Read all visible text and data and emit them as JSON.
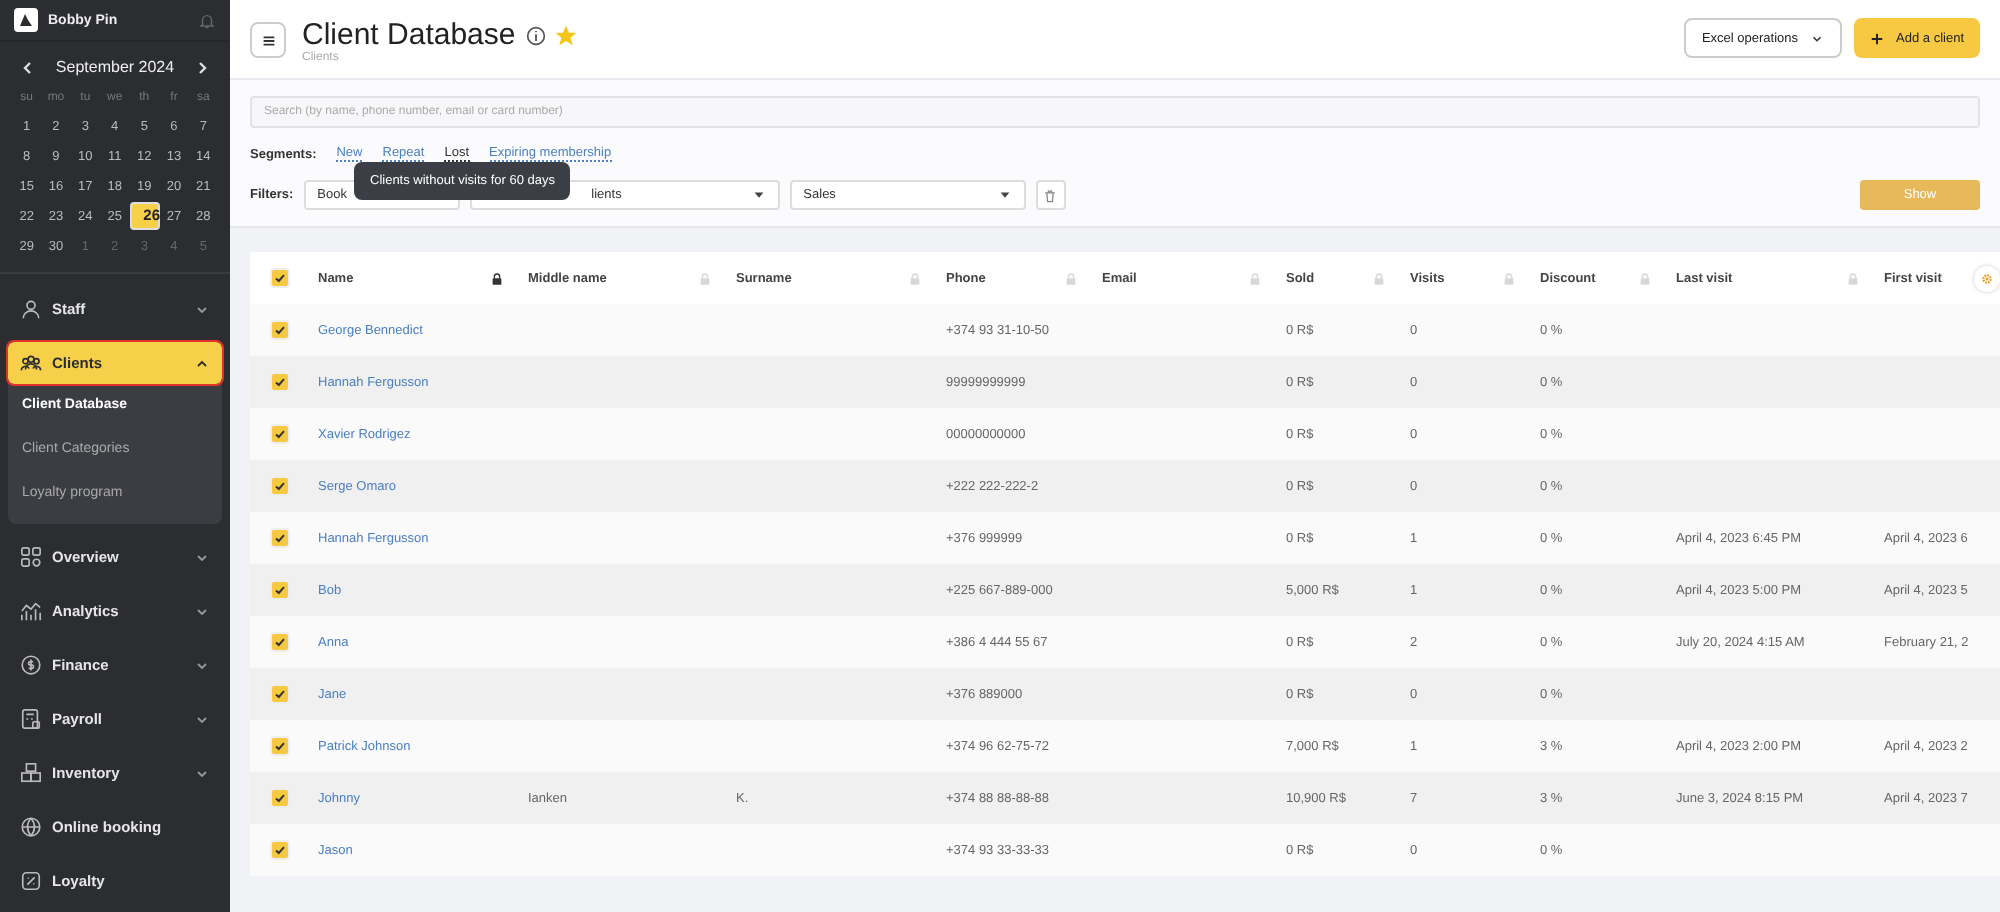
{
  "sidebar": {
    "account": {
      "name": "Bobby Pin"
    },
    "calendar": {
      "month": "September 2024",
      "weekdays": [
        "su",
        "mo",
        "tu",
        "we",
        "th",
        "fr",
        "sa"
      ],
      "days": [
        {
          "label": "1",
          "muted": false,
          "selected": false
        },
        {
          "label": "2",
          "muted": false,
          "selected": false
        },
        {
          "label": "3",
          "muted": false,
          "selected": false
        },
        {
          "label": "4",
          "muted": false,
          "selected": false
        },
        {
          "label": "5",
          "muted": false,
          "selected": false
        },
        {
          "label": "6",
          "muted": false,
          "selected": false
        },
        {
          "label": "7",
          "muted": false,
          "selected": false
        },
        {
          "label": "8",
          "muted": false,
          "selected": false
        },
        {
          "label": "9",
          "muted": false,
          "selected": false
        },
        {
          "label": "10",
          "muted": false,
          "selected": false
        },
        {
          "label": "11",
          "muted": false,
          "selected": false
        },
        {
          "label": "12",
          "muted": false,
          "selected": false
        },
        {
          "label": "13",
          "muted": false,
          "selected": false
        },
        {
          "label": "14",
          "muted": false,
          "selected": false
        },
        {
          "label": "15",
          "muted": false,
          "selected": false
        },
        {
          "label": "16",
          "muted": false,
          "selected": false
        },
        {
          "label": "17",
          "muted": false,
          "selected": false
        },
        {
          "label": "18",
          "muted": false,
          "selected": false
        },
        {
          "label": "19",
          "muted": false,
          "selected": false
        },
        {
          "label": "20",
          "muted": false,
          "selected": false
        },
        {
          "label": "21",
          "muted": false,
          "selected": false
        },
        {
          "label": "22",
          "muted": false,
          "selected": false
        },
        {
          "label": "23",
          "muted": false,
          "selected": false
        },
        {
          "label": "24",
          "muted": false,
          "selected": false
        },
        {
          "label": "25",
          "muted": false,
          "selected": false
        },
        {
          "label": "26",
          "muted": false,
          "selected": true
        },
        {
          "label": "27",
          "muted": false,
          "selected": false
        },
        {
          "label": "28",
          "muted": false,
          "selected": false
        },
        {
          "label": "29",
          "muted": false,
          "selected": false
        },
        {
          "label": "30",
          "muted": false,
          "selected": false
        },
        {
          "label": "1",
          "muted": true,
          "selected": false
        },
        {
          "label": "2",
          "muted": true,
          "selected": false
        },
        {
          "label": "3",
          "muted": true,
          "selected": false
        },
        {
          "label": "4",
          "muted": true,
          "selected": false
        },
        {
          "label": "5",
          "muted": true,
          "selected": false
        }
      ]
    },
    "items": [
      {
        "label": "Staff",
        "kind": "group",
        "expanded": false,
        "selected": false
      },
      {
        "label": "Clients",
        "kind": "group",
        "expanded": true,
        "selected": true,
        "children": [
          {
            "label": "Client Database",
            "selected": true
          },
          {
            "label": "Client Categories",
            "selected": false
          },
          {
            "label": "Loyalty program",
            "selected": false
          }
        ]
      },
      {
        "label": "Overview",
        "kind": "group",
        "expanded": false,
        "selected": false
      },
      {
        "label": "Analytics",
        "kind": "group",
        "expanded": false,
        "selected": false
      },
      {
        "label": "Finance",
        "kind": "group",
        "expanded": false,
        "selected": false
      },
      {
        "label": "Payroll",
        "kind": "group",
        "expanded": false,
        "selected": false
      },
      {
        "label": "Inventory",
        "kind": "group",
        "expanded": false,
        "selected": false
      },
      {
        "label": "Online booking",
        "kind": "link",
        "selected": false
      },
      {
        "label": "Loyalty",
        "kind": "link",
        "selected": false
      }
    ]
  },
  "header": {
    "title": "Client Database",
    "favorite": true,
    "breadcrumb": "Clients",
    "buttons": [
      {
        "label": "Excel operations",
        "kind": "dropdown"
      },
      {
        "label": "Add a client",
        "kind": "primary"
      }
    ]
  },
  "search": {
    "placeholder": "Search (by name, phone number, email or card number)"
  },
  "segments": {
    "label": "Segments:",
    "items": [
      {
        "label": "New",
        "hovered": false
      },
      {
        "label": "Repeat",
        "hovered": false
      },
      {
        "label": "Lost",
        "hovered": true
      },
      {
        "label": "Expiring membership",
        "hovered": false
      }
    ]
  },
  "filters": {
    "label": "Filters:",
    "selects": [
      "Book",
      "lients",
      "Sales"
    ],
    "show_button": "Show"
  },
  "tooltip": {
    "text": "Clients without visits for 60 days"
  },
  "table": {
    "all_checked": true,
    "columns": [
      {
        "label": "Name",
        "locked": true
      },
      {
        "label": "Middle name",
        "locked": false
      },
      {
        "label": "Surname",
        "locked": false
      },
      {
        "label": "Phone",
        "locked": false
      },
      {
        "label": "Email",
        "locked": false
      },
      {
        "label": "Sold",
        "locked": false
      },
      {
        "label": "Visits",
        "locked": false
      },
      {
        "label": "Discount",
        "locked": false
      },
      {
        "label": "Last visit",
        "locked": false
      },
      {
        "label": "First visit"
      }
    ],
    "rows": [
      {
        "checked": true,
        "cells": [
          "George Bennedict",
          "",
          "",
          "+374 93 31-10-50",
          "",
          "0 R$",
          "0",
          "0 %",
          "",
          ""
        ]
      },
      {
        "checked": true,
        "cells": [
          "Hannah Fergusson",
          "",
          "",
          "99999999999",
          "",
          "0 R$",
          "0",
          "0 %",
          "",
          ""
        ]
      },
      {
        "checked": true,
        "cells": [
          "Xavier Rodrigez",
          "",
          "",
          "00000000000",
          "",
          "0 R$",
          "0",
          "0 %",
          "",
          ""
        ]
      },
      {
        "checked": true,
        "cells": [
          "Serge Omaro",
          "",
          "",
          "+222 222-222-2",
          "",
          "0 R$",
          "0",
          "0 %",
          "",
          ""
        ]
      },
      {
        "checked": true,
        "cells": [
          "Hannah Fergusson",
          "",
          "",
          "+376 999999",
          "",
          "0 R$",
          "1",
          "0 %",
          "April 4, 2023 6:45 PM",
          "April 4, 2023 6"
        ]
      },
      {
        "checked": true,
        "cells": [
          "Bob",
          "",
          "",
          "+225 667-889-000",
          "",
          "5,000 R$",
          "1",
          "0 %",
          "April 4, 2023 5:00 PM",
          "April 4, 2023 5"
        ]
      },
      {
        "checked": true,
        "cells": [
          "Anna",
          "",
          "",
          "+386 4 444 55 67",
          "",
          "0 R$",
          "2",
          "0 %",
          "July 20, 2024 4:15 AM",
          "February 21, 2"
        ]
      },
      {
        "checked": true,
        "cells": [
          "Jane",
          "",
          "",
          "+376 889000",
          "",
          "0 R$",
          "0",
          "0 %",
          "",
          ""
        ]
      },
      {
        "checked": true,
        "cells": [
          "Patrick Johnson",
          "",
          "",
          "+374 96 62-75-72",
          "",
          "7,000 R$",
          "1",
          "3 %",
          "April 4, 2023 2:00 PM",
          "April 4, 2023 2"
        ]
      },
      {
        "checked": true,
        "cells": [
          "Johnny",
          "Ianken",
          "K.",
          "+374 88 88-88-88",
          "",
          "10,900 R$",
          "7",
          "3 %",
          "June 3, 2024 8:15 PM",
          "April 4, 2023 7"
        ]
      },
      {
        "checked": true,
        "cells": [
          "Jason",
          "",
          "",
          "+374 93 33-33-33",
          "",
          "0 R$",
          "0",
          "0 %",
          "",
          ""
        ]
      }
    ]
  }
}
